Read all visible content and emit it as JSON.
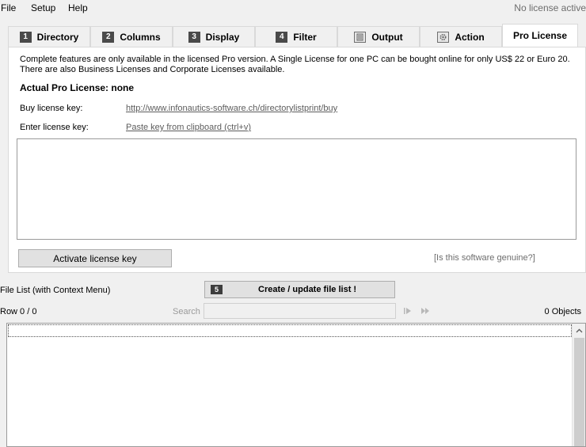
{
  "menu": {
    "items": [
      "File",
      "Setup",
      "Help"
    ],
    "license_status": "No license active"
  },
  "tabs": [
    {
      "number": "1",
      "label": "Directory"
    },
    {
      "number": "2",
      "label": "Columns"
    },
    {
      "number": "3",
      "label": "Display"
    },
    {
      "number": "4",
      "label": "Filter"
    },
    {
      "icon": "output-icon",
      "label": "Output"
    },
    {
      "icon": "action-gear-icon",
      "label": "Action"
    },
    {
      "label": "Pro License",
      "active": true
    }
  ],
  "pro_license": {
    "description": "Complete features are only available in the licensed Pro version. A Single License for one PC can be bought online for only US$ 22 or Euro 20. There are also Business Licenses and Corporate Licenses available.",
    "actual_license": "Actual Pro License: none",
    "buy_label": "Buy license key:",
    "buy_link": "http://www.infonautics-software.ch/directorylistprint/buy",
    "enter_label": "Enter license key:",
    "paste_link": "Paste key from clipboard (ctrl+v)",
    "key_value": "",
    "activate_button": "Activate license key",
    "genuine_link": "[Is this software genuine?]"
  },
  "file_list": {
    "label": "File List (with Context Menu)",
    "create_number": "5",
    "create_button": "Create / update file list !",
    "row_info": "Row 0 / 0",
    "search_label": "Search",
    "search_value": "",
    "objects": "0 Objects"
  }
}
